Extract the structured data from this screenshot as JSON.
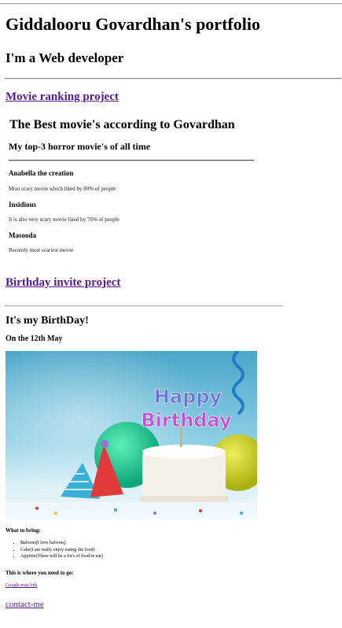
{
  "header": {
    "name_title": "Giddalooru Govardhan's portfolio",
    "role": "I'm a Web developer"
  },
  "projects": {
    "movie_link": "Movie ranking project",
    "birthday_link": "Birthday invite project"
  },
  "movie_ranking": {
    "title": "The Best movie's according to Govardhan",
    "subtitle": "My top-3 horror movie's of all time",
    "movies": [
      {
        "name": "Anabella the creation",
        "desc": "Most scary movie which liked by 80% of people"
      },
      {
        "name": "Insidious",
        "desc": "It is also very scary movie liked by 76% of people"
      },
      {
        "name": "Masooda",
        "desc": "Recently most scariest movie"
      }
    ]
  },
  "birthday": {
    "title": "It's my BirthDay!",
    "date": "On the 12th May",
    "cake_topper_line1": "Happy",
    "cake_topper_line2": "Birthday",
    "what_to_bring_heading": "What to bring:",
    "bring_items": [
      "Baloons(I love baloons)",
      "Cake(I am really enjoy eating the food)",
      "Appitite(There will be a lot's of food to eat)"
    ],
    "where_heading": "This is where you need to go:",
    "map_link": "Google map link"
  },
  "footer": {
    "contact_link": "contact-me"
  },
  "colors": {
    "link_visited": "#551a8b",
    "photo_bg_top": "#5fb3d3",
    "cake": "#f4f1ea"
  }
}
